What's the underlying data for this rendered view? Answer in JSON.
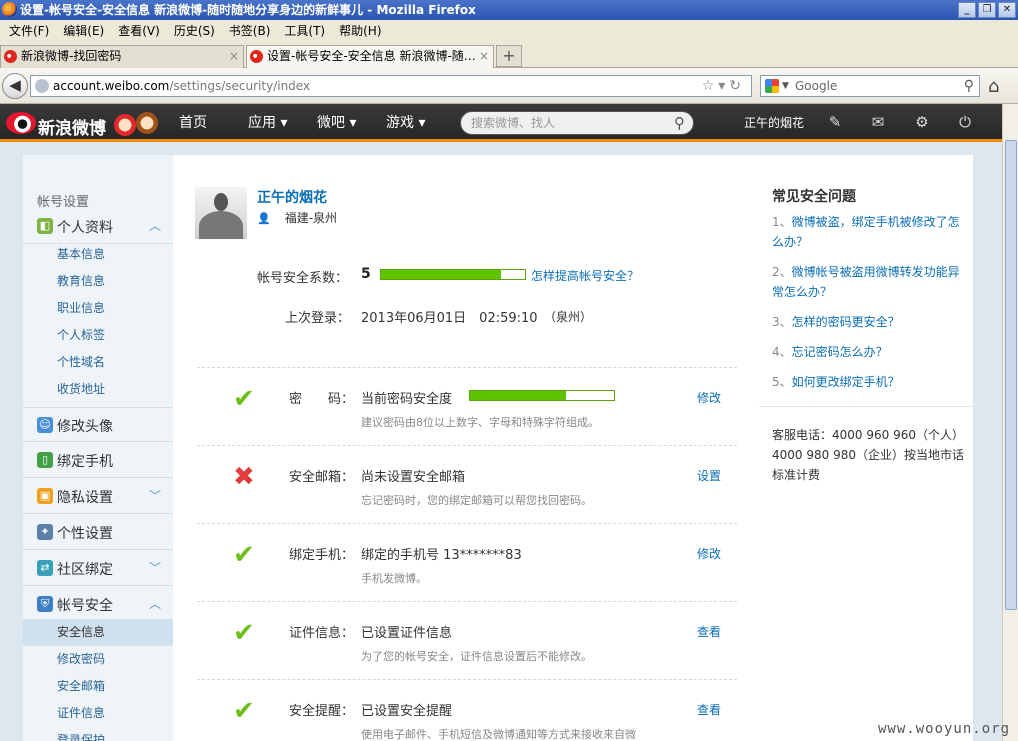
{
  "window": {
    "title": "设置-帐号安全-安全信息 新浪微博-随时随地分享身边的新鲜事儿 - Mozilla Firefox",
    "controls": [
      "_",
      "❐",
      "✕"
    ]
  },
  "menu": [
    "文件(F)",
    "编辑(E)",
    "查看(V)",
    "历史(S)",
    "书签(B)",
    "工具(T)",
    "帮助(H)"
  ],
  "tabs": [
    {
      "label": "新浪微博-找回密码",
      "close": "×"
    },
    {
      "label": "设置-帐号安全-安全信息 新浪微博-随…",
      "close": "×"
    }
  ],
  "newtab": "+",
  "nav": {
    "url_host": "account.weibo.com",
    "url_path": "/settings/security/index",
    "search_placeholder": "Google"
  },
  "weibo": {
    "logo_text": "新浪微博",
    "links": [
      "首页",
      "应用 ▾",
      "微吧 ▾",
      "游戏 ▾"
    ],
    "search_placeholder": "搜索微博、找人",
    "user": "正午的烟花"
  },
  "sidebar": {
    "title": "帐号设置",
    "groups": [
      {
        "label": "个人资料",
        "chevron": "︿"
      },
      {
        "label": "修改头像",
        "chevron": ""
      },
      {
        "label": "绑定手机",
        "chevron": ""
      },
      {
        "label": "隐私设置",
        "chevron": "﹀"
      },
      {
        "label": "个性设置",
        "chevron": ""
      },
      {
        "label": "社区绑定",
        "chevron": "﹀"
      },
      {
        "label": "帐号安全",
        "chevron": "︿"
      }
    ],
    "profile_items": [
      "基本信息",
      "教育信息",
      "职业信息",
      "个人标签",
      "个性域名",
      "收货地址"
    ],
    "security_items": [
      "安全信息",
      "修改密码",
      "安全邮箱",
      "证件信息",
      "登录保护"
    ]
  },
  "profile": {
    "name": "正午的烟花",
    "location": "福建-泉州"
  },
  "security": {
    "score_label": "帐号安全系数：",
    "score": "5",
    "score_fill": 0.83,
    "improve_link": "怎样提高帐号安全？",
    "last_login_label": "上次登录：",
    "last_login_value": "2013年06月01日　02:59:10",
    "last_login_city": "（泉州）",
    "password_fill": 0.67
  },
  "rows": [
    {
      "status": "✔",
      "label": "密　　码：",
      "value": "当前密码安全度",
      "desc": "建议密码由8位以上数字、字母和特殊字符组成。",
      "action": "修改"
    },
    {
      "status": "✖",
      "label": "安全邮箱：",
      "value": "尚未设置安全邮箱",
      "desc": "忘记密码时，您的绑定邮箱可以帮您找回密码。",
      "action": "设置"
    },
    {
      "status": "✔",
      "label": "绑定手机：",
      "value": "绑定的手机号 13*******83",
      "desc": "手机发微博。",
      "action": "修改"
    },
    {
      "status": "✔",
      "label": "证件信息：",
      "value": "已设置证件信息",
      "desc": "为了您的帐号安全，证件信息设置后不能修改。",
      "action": "查看"
    },
    {
      "status": "✔",
      "label": "安全提醒：",
      "value": "已设置安全提醒",
      "desc": "使用电子邮件、手机短信及微博通知等方式来接收来自微",
      "action": "查看"
    }
  ],
  "faq": {
    "title": "常见安全问题",
    "items": [
      {
        "num": "1、",
        "text": "微博被盗，绑定手机被修改了怎么办？"
      },
      {
        "num": "2、",
        "text": "微博帐号被盗用微博转发功能异常怎么办？"
      },
      {
        "num": "3、",
        "text": "怎样的密码更安全？"
      },
      {
        "num": "4、",
        "text": "忘记密码怎么办？"
      },
      {
        "num": "5、",
        "text": "如何更改绑定手机？"
      }
    ],
    "phone": "客服电话：4000 960 960（个人）4000 980 980（企业）按当地市话标准计费"
  },
  "watermark": "www.wooyun.org",
  "colors": {
    "accent": "#0a6eb5",
    "ok": "#6fbf1a",
    "bad": "#e23d3d",
    "bar": "#5fc300",
    "nav_bottom": "#f28b00"
  }
}
